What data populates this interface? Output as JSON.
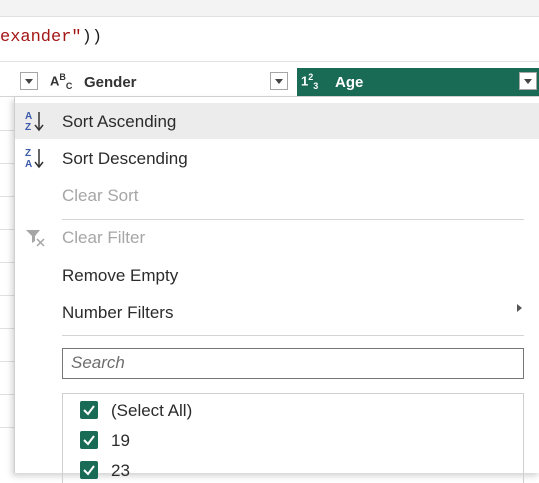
{
  "formula": {
    "prefix": "exander",
    "suffix": "\"))"
  },
  "columns": [
    {
      "type_icon": "ABC",
      "label": "Gender",
      "selected": false
    },
    {
      "type_icon": "123",
      "label": "Age",
      "selected": true
    }
  ],
  "colors": {
    "accent": "#1a6b56",
    "highlight": "#ececec",
    "disabled_text": "#a6a6a6"
  },
  "menu": {
    "sort_ascending": {
      "label": "Sort Ascending",
      "icon": "sort-ascending-icon"
    },
    "sort_descending": {
      "label": "Sort Descending",
      "icon": "sort-descending-icon"
    },
    "clear_sort": {
      "label": "Clear Sort",
      "disabled": true
    },
    "clear_filter": {
      "label": "Clear Filter",
      "icon": "clear-filter-icon",
      "disabled": true
    },
    "remove_empty": {
      "label": "Remove Empty"
    },
    "number_filters": {
      "label": "Number Filters",
      "has_submenu": true
    }
  },
  "search": {
    "placeholder": "Search",
    "value": ""
  },
  "values": [
    {
      "label": "(Select All)",
      "checked": true
    },
    {
      "label": "19",
      "checked": true
    },
    {
      "label": "23",
      "checked": true
    }
  ]
}
